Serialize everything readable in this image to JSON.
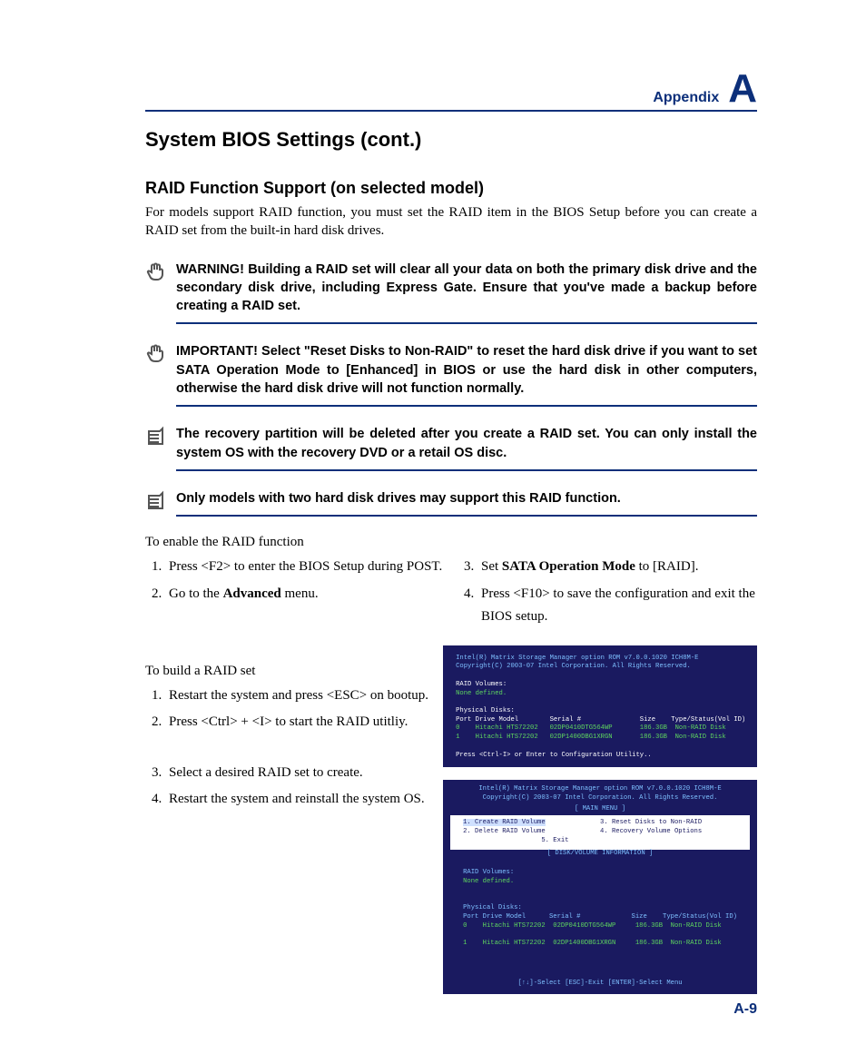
{
  "header": {
    "appendix_label": "Appendix",
    "appendix_letter": "A"
  },
  "h1": "System BIOS Settings (cont.)",
  "h2": "RAID Function Support (on selected model)",
  "intro": "For models support RAID function, you must set the RAID item in the BIOS Setup before you can create a RAID set from the built-in hard disk drives.",
  "notes": {
    "warning": "WARNING! Building a RAID set will clear all your data on both the primary disk drive and the secondary disk drive, including Express Gate. Ensure that you've made a backup before creating a RAID set.",
    "important": "IMPORTANT! Select \"Reset Disks to Non-RAID\" to reset the hard disk drive if you want to set SATA Operation Mode to [Enhanced] in BIOS or use the hard disk in other computers, otherwise the hard disk drive will not function normally.",
    "recovery": "The recovery partition will be deleted after you create a RAID set. You can only install the system OS with the recovery DVD or a retail OS disc.",
    "models": "Only models with two hard disk drives may support this RAID function."
  },
  "enable_heading": "To enable the RAID function",
  "enable_steps_left": [
    "Press <F2> to enter the BIOS Setup during POST.",
    "Go to the <b>Advanced</b> menu."
  ],
  "enable_steps_right": [
    "Set <b>SATA Operation Mode</b> to [RAID].",
    "Press <F10> to save the configuration and exit the BIOS setup."
  ],
  "build_heading": "To build a RAID set",
  "build_steps_a": [
    "Restart the system and press <ESC> on bootup.",
    "Press <Ctrl> + <I> to start the RAID utitliy."
  ],
  "build_steps_b": [
    "Select a desired RAID set to create.",
    "Restart the system and reinstall the system OS."
  ],
  "bios1": {
    "title": "Intel(R) Matrix Storage Manager option ROM v7.0.0.1020 ICH8M-E",
    "copyright": "Copyright(C) 2003-07 Intel Corporation. All Rights Reserved.",
    "raid_volumes_label": "RAID Volumes:",
    "raid_volumes_value": "None defined.",
    "phys_label": "Physical Disks:",
    "table_header": "Port Drive Model        Serial #               Size    Type/Status(Vol ID)",
    "row0": "0    Hitachi HTS72202   02DP0410DTG564WP       186.3GB  Non-RAID Disk",
    "row1": "1    Hitachi HTS72202   02DP1400DBG1XRGN       186.3GB  Non-RAID Disk",
    "prompt": "Press <Ctrl-I> or Enter to Configuration Utility.."
  },
  "bios2": {
    "title": "Intel(R) Matrix Storage Manager option ROM v7.0.0.1020 ICH8M-E",
    "copyright": "Copyright(C) 2003-07 Intel Corporation. All Rights Reserved.",
    "main_menu_label": "[ MAIN MENU ]",
    "menu_l1": "1. Create RAID Volume",
    "menu_r1": "3. Reset Disks to Non-RAID",
    "menu_l2": "2. Delete RAID Volume",
    "menu_r2": "4. Recovery Volume Options",
    "menu_exit": "5. Exit",
    "info_label": "[ DISK/VOLUME INFORMATION ]",
    "raid_volumes_label": "RAID Volumes:",
    "raid_volumes_value": "None defined.",
    "phys_label": "Physical Disks:",
    "table_header": "Port Drive Model      Serial #             Size    Type/Status(Vol ID)",
    "row0": "0    Hitachi HTS72202  02DP0410DTG564WP     186.3GB  Non-RAID Disk",
    "row1": "1    Hitachi HTS72202  02DP1400DBG1XRGN     186.3GB  Non-RAID Disk",
    "footer": "[↑↓]-Select        [ESC]-Exit        [ENTER]-Select Menu"
  },
  "page_number": "A-9"
}
